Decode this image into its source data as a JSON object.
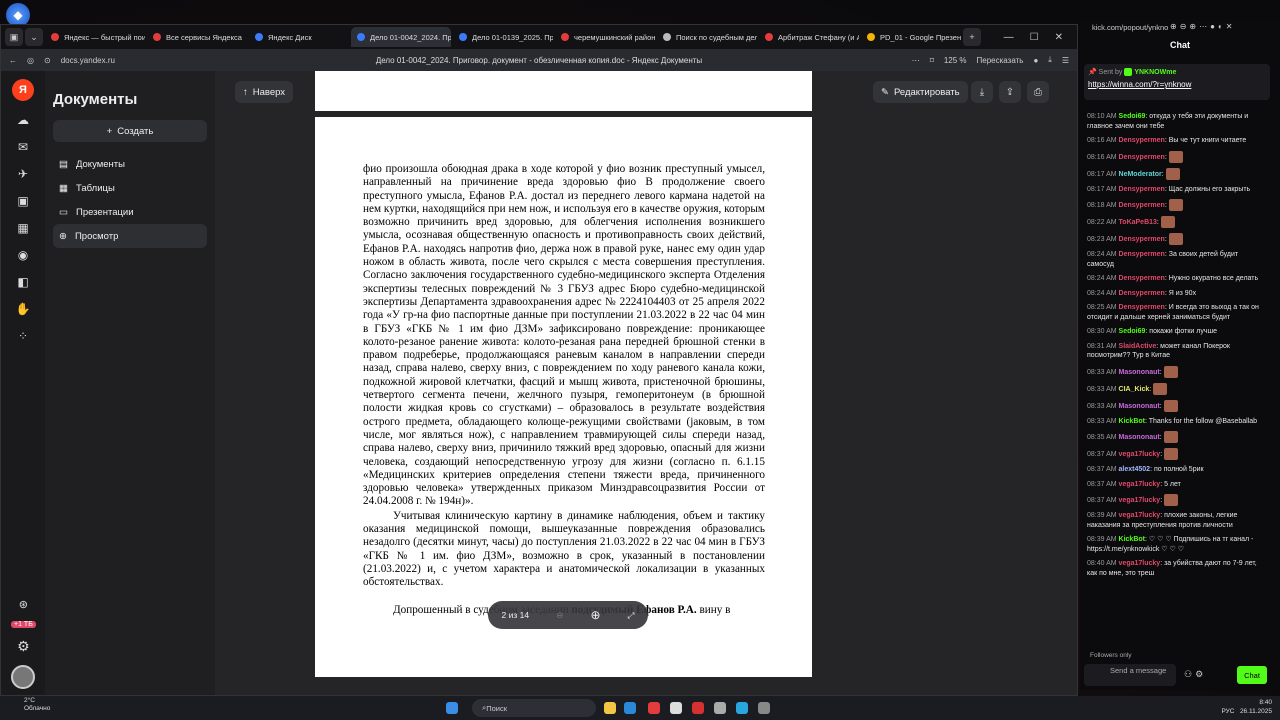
{
  "browser": {
    "tabs": [
      {
        "label": "Яндекс — быстрый поиск",
        "color": "#e43c3c"
      },
      {
        "label": "Все сервисы Яндекса",
        "color": "#e43c3c"
      },
      {
        "label": "Яндекс Диск",
        "color": "#3a7bfd"
      },
      {
        "label": "Дело 01-0042_2024. Пр",
        "color": "#3a7bfd"
      },
      {
        "label": "Дело 01-0139_2025. Пр",
        "color": "#3a7bfd"
      },
      {
        "label": "черемушкинский район",
        "color": "#e43c3c"
      },
      {
        "label": "Поиск по судебным дел",
        "color": "#bbbbbb"
      },
      {
        "label": "Арбитраж Стефану (и А",
        "color": "#e43c3c"
      },
      {
        "label": "PD_01 - Google Презента",
        "color": "#f4b400"
      }
    ],
    "url": "docs.yandex.ru",
    "page_title": "Дело 01-0042_2024. Приговор. документ - обезличенная копия.doc - Яндекс Документы",
    "zoom": "125 %",
    "retell": "Пересказать"
  },
  "sidebar": {
    "title": "Документы",
    "create": "Создать",
    "items": [
      "Документы",
      "Таблицы",
      "Презентации",
      "Просмотр"
    ],
    "quota": "+1 ТБ"
  },
  "toolbar": {
    "back": "Наверх",
    "edit": "Редактировать"
  },
  "doc": {
    "para1": "фио произошла обоюдная драка в ходе которой у фио возник преступный умысел, направленный на причинение вреда здоровью фио В продолжение своего преступного умысла, Ефанов Р.А. достал из переднего левого кармана надетой на нем куртки, находящийся при нем нож, и используя его в качестве оружия, которым возможно причинить вред здоровью, для облегчения исполнения возникшего умысла, осознавая общественную опасность и противоправность своих действий, Ефанов Р.А. находясь напротив фио, держа нож в правой руке, нанес ему один удар ножом в область живота, после чего скрылся с места совершения преступления. Согласно заключения государственного судебно-медицинского эксперта Отделения экспертизы телесных повреждений № 3 ГБУЗ адрес Бюро судебно-медицинской экспертизы Департамента здравоохранения адрес № 2224104403 от 25 апреля 2022 года «У гр-на фио паспортные данные при поступлении 21.03.2022 в 22 час 04 мин в ГБУЗ «ГКБ № 1 им фио ДЗМ» зафиксировано повреждение: проникающее колото-резаное ранение живота: колото-резаная рана передней брюшной стенки в правом подреберье, продолжающаяся раневым каналом в направлении спереди назад, справа налево, сверху вниз, с повреждением по ходу раневого канала кожи, подкожной жировой клетчатки, фасций и мышц живота, пристеночной брюшины, четвертого сегмента печени, желчного пузыря, гемоперитонеум (в брюшной полости жидкая кровь со сгустками) – образовалось в результате воздействия острого предмета, обладающего колюще-режущими свойствами (јаковым, в том числе, мог являться нож), с направлением травмирующей силы спереди назад, справа налево, сверху вниз, причинило тяжкий вред здоровью, опасный для жизни человека, создающий непосредственную угрозу для жизни (согласно п. 6.1.15 «Медицинских критериев определения степени тяжести вреда, причиненного здоровью человека» утвержденных приказом Минздравсоцразвития России от 24.04.2008 г. № 194н)».",
    "para2": "Учитывая клиническую картину в динамике наблюдения, объем и тактику оказания медицинской помощи, вышеуказанные повреждения образовались незадолго (десятки минут, часы) до поступления 21.03.2022 в 22 час 04 мин в ГБУЗ «ГКБ № 1 им. фио ДЗМ», возможно в срок, указанный в постановлении (21.03.2022) и, с учетом характера и анатомической локализации в указанных обстоятельствах.",
    "para3_start": "Допрошенный в судебном заседании ",
    "para3_bold": "подсудимый Ефанов Р.А.",
    "para3_end": " вину в",
    "pager": "2 из 14"
  },
  "chat": {
    "url": "kick.com/popout/ynkno",
    "title": "Chat",
    "pinned_sender": "Sent by",
    "pinned_user": "YNKNOWme",
    "pinned_link": "https://winna.com/?r=ynknow",
    "messages": [
      {
        "t": "08:10 AM",
        "u": "Sedoi69",
        "c": "#53fc18",
        "m": "откуда у тебя эти документы и главное зачем они тебе"
      },
      {
        "t": "08:16 AM",
        "u": "Densypermen",
        "c": "#e0486a",
        "m": "Вы че тут книги читаете"
      },
      {
        "t": "08:16 AM",
        "u": "Densypermen",
        "c": "#e0486a",
        "m": ""
      },
      {
        "t": "08:17 AM",
        "u": "NeModerator",
        "c": "#5fd4d4",
        "m": ""
      },
      {
        "t": "08:17 AM",
        "u": "Densypermen",
        "c": "#e0486a",
        "m": "Щас должны его закрыть"
      },
      {
        "t": "08:18 AM",
        "u": "Densypermen",
        "c": "#e0486a",
        "m": ""
      },
      {
        "t": "08:22 AM",
        "u": "ToKaPeB13",
        "c": "#e0486a",
        "m": ""
      },
      {
        "t": "08:23 AM",
        "u": "Densypermen",
        "c": "#e0486a",
        "m": ""
      },
      {
        "t": "08:24 AM",
        "u": "Densypermen",
        "c": "#e0486a",
        "m": "За своих детей будит самосуд"
      },
      {
        "t": "08:24 AM",
        "u": "Densypermen",
        "c": "#e0486a",
        "m": "Нужно окуратно все делать"
      },
      {
        "t": "08:24 AM",
        "u": "Densypermen",
        "c": "#e0486a",
        "m": "Я из 90х"
      },
      {
        "t": "08:25 AM",
        "u": "Densypermen",
        "c": "#e0486a",
        "m": "И всегда это выход а так он отсидит и дальше херней заниматься будит"
      },
      {
        "t": "08:30 AM",
        "u": "Sedoi69",
        "c": "#53fc18",
        "m": "покажи фотки лучше"
      },
      {
        "t": "08:31 AM",
        "u": "SlaidActive",
        "c": "#e0486a",
        "m": "может канал Покерок посмотрим?? Тур в Китае"
      },
      {
        "t": "08:33 AM",
        "u": "Masononaut",
        "c": "#c86ad8",
        "m": ""
      },
      {
        "t": "08:33 AM",
        "u": "CIA_Kick",
        "c": "#e6e66a",
        "m": ""
      },
      {
        "t": "08:33 AM",
        "u": "Masononaut",
        "c": "#c86ad8",
        "m": ""
      },
      {
        "t": "08:33 AM",
        "u": "KickBot",
        "c": "#53fc18",
        "m": "Thanks for the follow @Baseballab"
      },
      {
        "t": "08:35 AM",
        "u": "Masononaut",
        "c": "#c86ad8",
        "m": ""
      },
      {
        "t": "08:37 AM",
        "u": "vega17lucky",
        "c": "#e0486a",
        "m": ""
      },
      {
        "t": "08:37 AM",
        "u": "alext4502",
        "c": "#a0b8ff",
        "m": "по полной 5рик"
      },
      {
        "t": "08:37 AM",
        "u": "vega17lucky",
        "c": "#e0486a",
        "m": "5 лет"
      },
      {
        "t": "08:37 AM",
        "u": "vega17lucky",
        "c": "#e0486a",
        "m": ""
      },
      {
        "t": "08:39 AM",
        "u": "vega17lucky",
        "c": "#e0486a",
        "m": "плохие законы, легкие наказания за преступления против личности"
      },
      {
        "t": "08:39 AM",
        "u": "KickBot",
        "c": "#53fc18",
        "m": "♡ ♡ ♡ Подпишись на тг канал - https://t.me/ynknowkick ♡ ♡ ♡"
      },
      {
        "t": "08:40 AM",
        "u": "vega17lucky",
        "c": "#e0486a",
        "m": "за убийства дают по 7-9 лет, как по мне, это треш"
      }
    ],
    "followers_only": "Followers only",
    "input_placeholder": "Send a message",
    "send": "Chat"
  },
  "taskbar": {
    "temp": "2°C",
    "weather": "Облачно",
    "search": "Поиск",
    "lang": "РУС",
    "time": "8:40",
    "date": "26.11.2025"
  }
}
